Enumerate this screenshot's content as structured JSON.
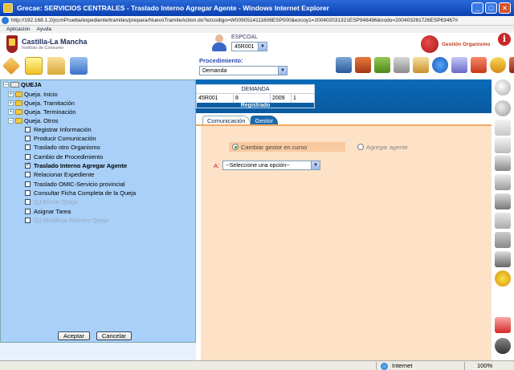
{
  "window": {
    "title": "Grecae: SERVICIOS CENTRALES - Traslado Interno Agregar Agente - Windows Internet Explorer",
    "url": "http://192.168.1.2/jccmPrueba/expediente/tramites/prepararNuevoTramiteAction.do?ezcodigo=W0090514111606ESP000&ezcoy1=200402031321ESP948496&nodo=200403261726ESP63467#"
  },
  "menu": [
    "Aplicación",
    "Ayuda"
  ],
  "header": {
    "brand": "Castilla-La Mancha",
    "brand_sub": "Instituto de Consumo",
    "user_code": "ESPCOAL",
    "oficina_value": "45R001",
    "gestion_label": "Gestión Organismo",
    "info_icon": "i",
    "procedimiento_label": "Procedimiento:",
    "procedimiento_value": "Demanda"
  },
  "demanda": {
    "title": "DEMANDA",
    "cells": [
      "45R001",
      "8",
      "2009",
      "1"
    ],
    "status": "Registrado"
  },
  "tabs": [
    "Comunicación",
    "Gestor"
  ],
  "form": {
    "radio_selected": "Cambiar gestor en curso",
    "radio_other": "Agregar agente",
    "a_label": "A:",
    "a_select_value": "--Seleccione una opción--"
  },
  "tree": {
    "root": "QUEJA",
    "folders": [
      "Queja. Inicio",
      "Queja. Tramitación",
      "Queja. Terminación",
      "Queja. Otros"
    ],
    "tasks": [
      {
        "label": "Registrar Información",
        "state": "normal"
      },
      {
        "label": "Producir Comunicación",
        "state": "normal"
      },
      {
        "label": "Traslado otro Organismo",
        "state": "normal"
      },
      {
        "label": "Cambio de Procedimiento",
        "state": "normal"
      },
      {
        "label": "Traslado Interno Agregar Agente",
        "state": "checked"
      },
      {
        "label": "Relacionar Expediente",
        "state": "normal"
      },
      {
        "label": "Traslado OMIC-Servicio provincial",
        "state": "normal"
      },
      {
        "label": "Consultar Ficha Completa de la Queja",
        "state": "normal"
      },
      {
        "label": "QJ.Borrar Queja",
        "state": "disabled"
      },
      {
        "label": "Asignar Tarea",
        "state": "normal"
      },
      {
        "label": "QJ.Modificar Número Queja",
        "state": "disabled"
      }
    ],
    "accept_label": "Aceptar",
    "cancel_label": "Cancelar"
  },
  "statusbar": {
    "zone": "Internet",
    "zoom": "100%"
  }
}
